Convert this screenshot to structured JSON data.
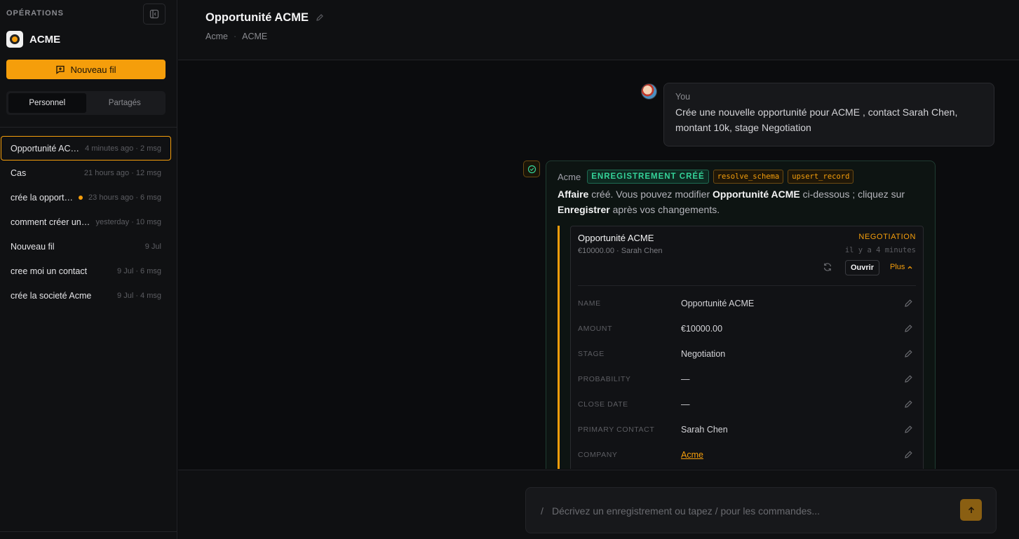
{
  "sidebar": {
    "section_label": "OPÉRATIONS",
    "brand_name": "ACME",
    "new_thread_label": "Nouveau fil",
    "tabs": [
      {
        "label": "Personnel",
        "active": true
      },
      {
        "label": "Partagés",
        "active": false
      }
    ],
    "threads": [
      {
        "title": "Opportunité ACME",
        "meta": "4 minutes ago · 2 msg",
        "active": true,
        "unread": false
      },
      {
        "title": "Cas",
        "meta": "21 hours ago · 12 msg",
        "active": false,
        "unread": false
      },
      {
        "title": "crée la opportunité",
        "meta": "23 hours ago · 6 msg",
        "active": false,
        "unread": true
      },
      {
        "title": "comment créer un cas",
        "meta": "yesterday · 10 msg",
        "active": false,
        "unread": false
      },
      {
        "title": "Nouveau fil",
        "meta": "9 Jul",
        "active": false,
        "unread": false
      },
      {
        "title": "cree moi un contact",
        "meta": "9 Jul · 6 msg",
        "active": false,
        "unread": false
      },
      {
        "title": "crée la societé Acme",
        "meta": "9 Jul · 4 msg",
        "active": false,
        "unread": false
      }
    ]
  },
  "header": {
    "title": "Opportunité ACME",
    "breadcrumb": [
      "Acme",
      "ACME"
    ]
  },
  "messages": {
    "user": {
      "author": "You",
      "text": "Crée une nouvelle opportunité pour ACME , contact Sarah Chen, montant 10k, stage Negotiation"
    },
    "assistant": {
      "source": "Acme",
      "badges": [
        "ENREGISTREMENT CRÉÉ",
        "resolve_schema",
        "upsert_record"
      ],
      "text_parts": {
        "entity": "Affaire",
        "t1": " créé. Vous pouvez modifier ",
        "record": "Opportunité ACME",
        "t2": " ci-dessous ; cliquez sur ",
        "action": "Enregistrer",
        "t3": " après vos changements."
      }
    }
  },
  "record": {
    "title": "Opportunité ACME",
    "stage_badge": "NEGOTIATION",
    "subtitle": "€10000.00 · Sarah Chen",
    "updated": "il y a 4 minutes",
    "open_label": "Ouvrir",
    "more_label": "Plus",
    "fields": [
      {
        "label": "NAME",
        "value": "Opportunité ACME"
      },
      {
        "label": "AMOUNT",
        "value": "€10000.00"
      },
      {
        "label": "STAGE",
        "value": "Negotiation"
      },
      {
        "label": "PROBABILITY",
        "value": "—"
      },
      {
        "label": "CLOSE DATE",
        "value": "—"
      },
      {
        "label": "PRIMARY CONTACT",
        "value": "Sarah Chen"
      },
      {
        "label": "COMPANY",
        "value": "Acme",
        "link": true
      }
    ]
  },
  "composer": {
    "prefix": "/",
    "placeholder": "Décrivez un enregistrement ou tapez / pour les commandes..."
  },
  "colors": {
    "accent": "#f59e0b",
    "success": "#34d399",
    "background": "#0b0c0e"
  }
}
